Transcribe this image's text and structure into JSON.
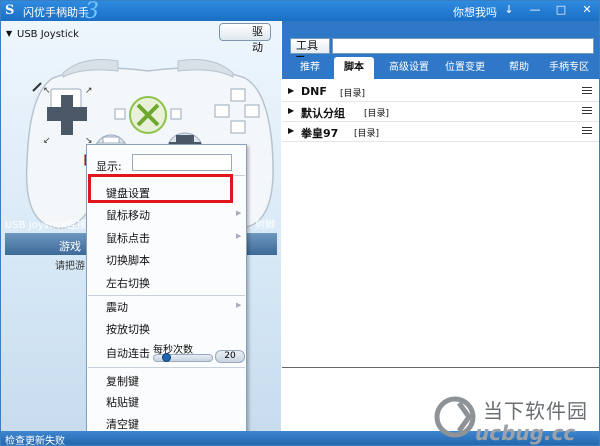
{
  "app": {
    "title": "闪优手柄助手",
    "version_mark": "3",
    "greeting": "你想我吗",
    "window_controls": [
      "↓",
      "—",
      "□",
      "✕"
    ]
  },
  "left": {
    "driver_button": "驱动",
    "joystick_label": "USB Joystick",
    "status_text": "USB Joystick连接成功",
    "status_right": "射脚本",
    "game_tab": "游戏",
    "hint": "请把游"
  },
  "right": {
    "tool_button": "工具 ▼",
    "tool_input": "",
    "tabs": [
      "推荐",
      "脚本",
      "高级设置",
      "位置变更",
      "帮助",
      "手柄专区"
    ],
    "active_tab": "脚本",
    "rows": [
      {
        "name": "DNF",
        "tag": "[目录]"
      },
      {
        "name": "默认分组",
        "tag": "[目录]"
      },
      {
        "name": "拳皇97",
        "tag": "[目录]"
      }
    ]
  },
  "context_menu": {
    "display_label": "显示:",
    "display_value": "",
    "group1": [
      "键盘设置",
      "鼠标移动",
      "鼠标点击",
      "切换脚本",
      "左右切换"
    ],
    "group2": [
      "震动",
      "按放切换",
      "自动连击"
    ],
    "per_second_label": "每秒次数",
    "per_second_value": "20",
    "per_second_level": 0.17,
    "group3": [
      "复制键",
      "粘贴键",
      "清空键"
    ]
  },
  "statusbar": {
    "text": "检查更新失败"
  },
  "watermark": {
    "cn": "当下软件园",
    "en": "ucbug.cc"
  },
  "colors": {
    "accent": "#2f78c8",
    "highlight": "#e0161b"
  }
}
